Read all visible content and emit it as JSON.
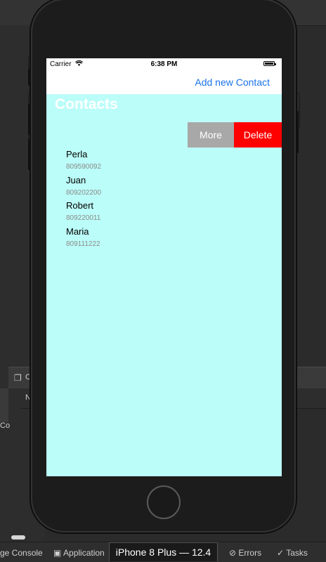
{
  "app": {
    "carrier": "Carrier",
    "time": "6:38 PM",
    "battery_level": 1.0,
    "navbar_action": "Add new Contact",
    "title": "Contacts",
    "swipe_actions": [
      {
        "label": "More",
        "color": "#a8a8a8"
      },
      {
        "label": "Delete",
        "color": "#ff0000"
      }
    ],
    "contacts": [
      {
        "name": "Perla",
        "phone": "809590092"
      },
      {
        "name": "Juan",
        "phone": "809202200"
      },
      {
        "name": "Robert",
        "phone": "809220011"
      },
      {
        "name": "Maria",
        "phone": "809111222"
      }
    ],
    "background_color": "#bbfdf8",
    "link_color": "#1a73e8"
  },
  "ide": {
    "panel_label_1": "C",
    "panel_label_2": "N",
    "panel_label_3": "Co",
    "status_items": {
      "console": "ge Console",
      "application": "Application",
      "device": "iPhone 8 Plus — 12.4",
      "errors": "Errors",
      "tasks": "Tasks"
    }
  }
}
